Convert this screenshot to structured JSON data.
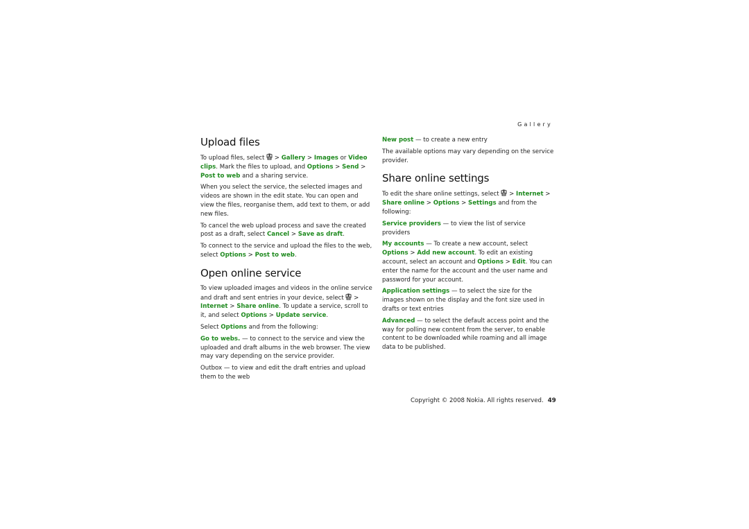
{
  "header": {
    "section": "Gallery"
  },
  "left": {
    "upload": {
      "title": "Upload files",
      "p1": {
        "t1": "To upload files, select ",
        "icon": "menu-key-icon",
        "t2": " > ",
        "gallery": "Gallery",
        "t3": " > ",
        "images": "Images",
        "t4": " or ",
        "video": "Video clips",
        "t5": ". Mark the files to upload, and ",
        "options": "Options",
        "t6": " > ",
        "send": "Send",
        "t7": " > ",
        "post": "Post to web",
        "t8": " and a sharing service."
      },
      "p2": "When you select the service, the selected images and videos are shown in the edit state. You can open and view the files, reorganise them, add text to them, or add new files.",
      "p3": {
        "t1": "To cancel the web upload process and save the created post as a draft, select ",
        "cancel": "Cancel",
        "t2": " > ",
        "save": "Save as draft",
        "t3": "."
      },
      "p4": {
        "t1": "To connect to the service and upload the files to the web, select ",
        "options": "Options",
        "t2": " > ",
        "post": "Post to web",
        "t3": "."
      }
    },
    "open": {
      "title": "Open online service",
      "p1": {
        "t1": "To view uploaded images and videos in the online service and draft and sent entries in your device, select ",
        "icon": "menu-key-icon",
        "t2": " > ",
        "internet": "Internet",
        "t3": " > ",
        "share": "Share online",
        "t4": ". To update a service, scroll to it, and select ",
        "options": "Options",
        "t5": " > ",
        "update": "Update service",
        "t6": "."
      },
      "p2": {
        "t1": "Select ",
        "options": "Options",
        "t2": " and from the following:"
      },
      "p3": {
        "term": "Go to webs.",
        "t1": " — to connect to the service and view the uploaded and draft albums in the web browser. The view may vary depending on the service provider."
      },
      "p4": "Outbox — to view and edit the draft entries and upload them to the web"
    }
  },
  "right": {
    "p1": {
      "term": "New post",
      "t1": " — to create a new entry"
    },
    "p2": "The available options may vary depending on the service provider.",
    "settings": {
      "title": "Share online settings",
      "p1": {
        "t1": "To edit the share online settings, select ",
        "icon": "menu-key-icon",
        "t2": " > ",
        "internet": "Internet",
        "t3": " > ",
        "share": "Share online",
        "t4": " > ",
        "options": "Options",
        "t5": " > ",
        "settings": "Settings",
        "t6": " and from the following:"
      },
      "p2": {
        "term": "Service providers",
        "t1": " — to view the list of service providers"
      },
      "p3": {
        "term": "My accounts",
        "t1": " — To create a new account, select ",
        "options": "Options",
        "t2": " > ",
        "add": "Add new account",
        "t3": ". To edit an existing account, select an account and ",
        "options2": "Options",
        "t4": " > ",
        "edit": "Edit",
        "t5": ". You can enter the name for the account and the user name and password for your account."
      },
      "p4": {
        "term": "Application settings",
        "t1": " — to select the size for the images shown on the display and the font size used in drafts or text entries"
      },
      "p5": {
        "term": "Advanced",
        "t1": " — to select the default access point and the way for polling new content from the server, to enable content to be downloaded while roaming and all image data to be published."
      }
    }
  },
  "footer": {
    "copyright": "Copyright © 2008 Nokia. All rights reserved.",
    "page": "49"
  }
}
